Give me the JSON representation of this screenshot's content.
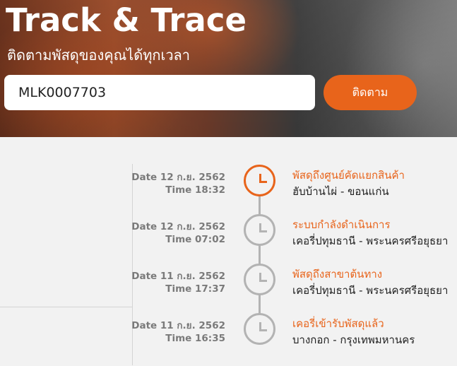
{
  "header": {
    "title": "Track & Trace",
    "subtitle": "ติดตามพัสดุของคุณได้ทุกเวลา"
  },
  "search": {
    "value": "MLK0007703",
    "button_label": "ติดตาม"
  },
  "colors": {
    "accent": "#e8641b",
    "timeline_gray": "#b3b3b3",
    "background": "#f2f2f2"
  },
  "timeline": [
    {
      "date": "Date 12 ก.ย. 2562",
      "time": "Time 18:32",
      "status": "พัสดุถึงศูนย์คัดแยกสินค้า",
      "location": "ฮับบ้านไผ่ - ขอนแก่น",
      "active": true,
      "icon": "clock-icon"
    },
    {
      "date": "Date 12 ก.ย. 2562",
      "time": "Time 07:02",
      "status": "ระบบกำลังดำเนินการ",
      "location": "เคอรี่ปทุมธานี - พระนครศรีอยุธยา",
      "active": false,
      "icon": "clock-icon"
    },
    {
      "date": "Date 11 ก.ย. 2562",
      "time": "Time 17:37",
      "status": "พัสดุถึงสาขาต้นทาง",
      "location": "เคอรี่ปทุมธานี - พระนครศรีอยุธยา",
      "active": false,
      "icon": "clock-icon"
    },
    {
      "date": "Date 11 ก.ย. 2562",
      "time": "Time 16:35",
      "status": "เคอรี่เข้ารับพัสดุแล้ว",
      "location": "บางกอก - กรุงเทพมหานคร",
      "active": false,
      "icon": "clock-icon"
    }
  ]
}
